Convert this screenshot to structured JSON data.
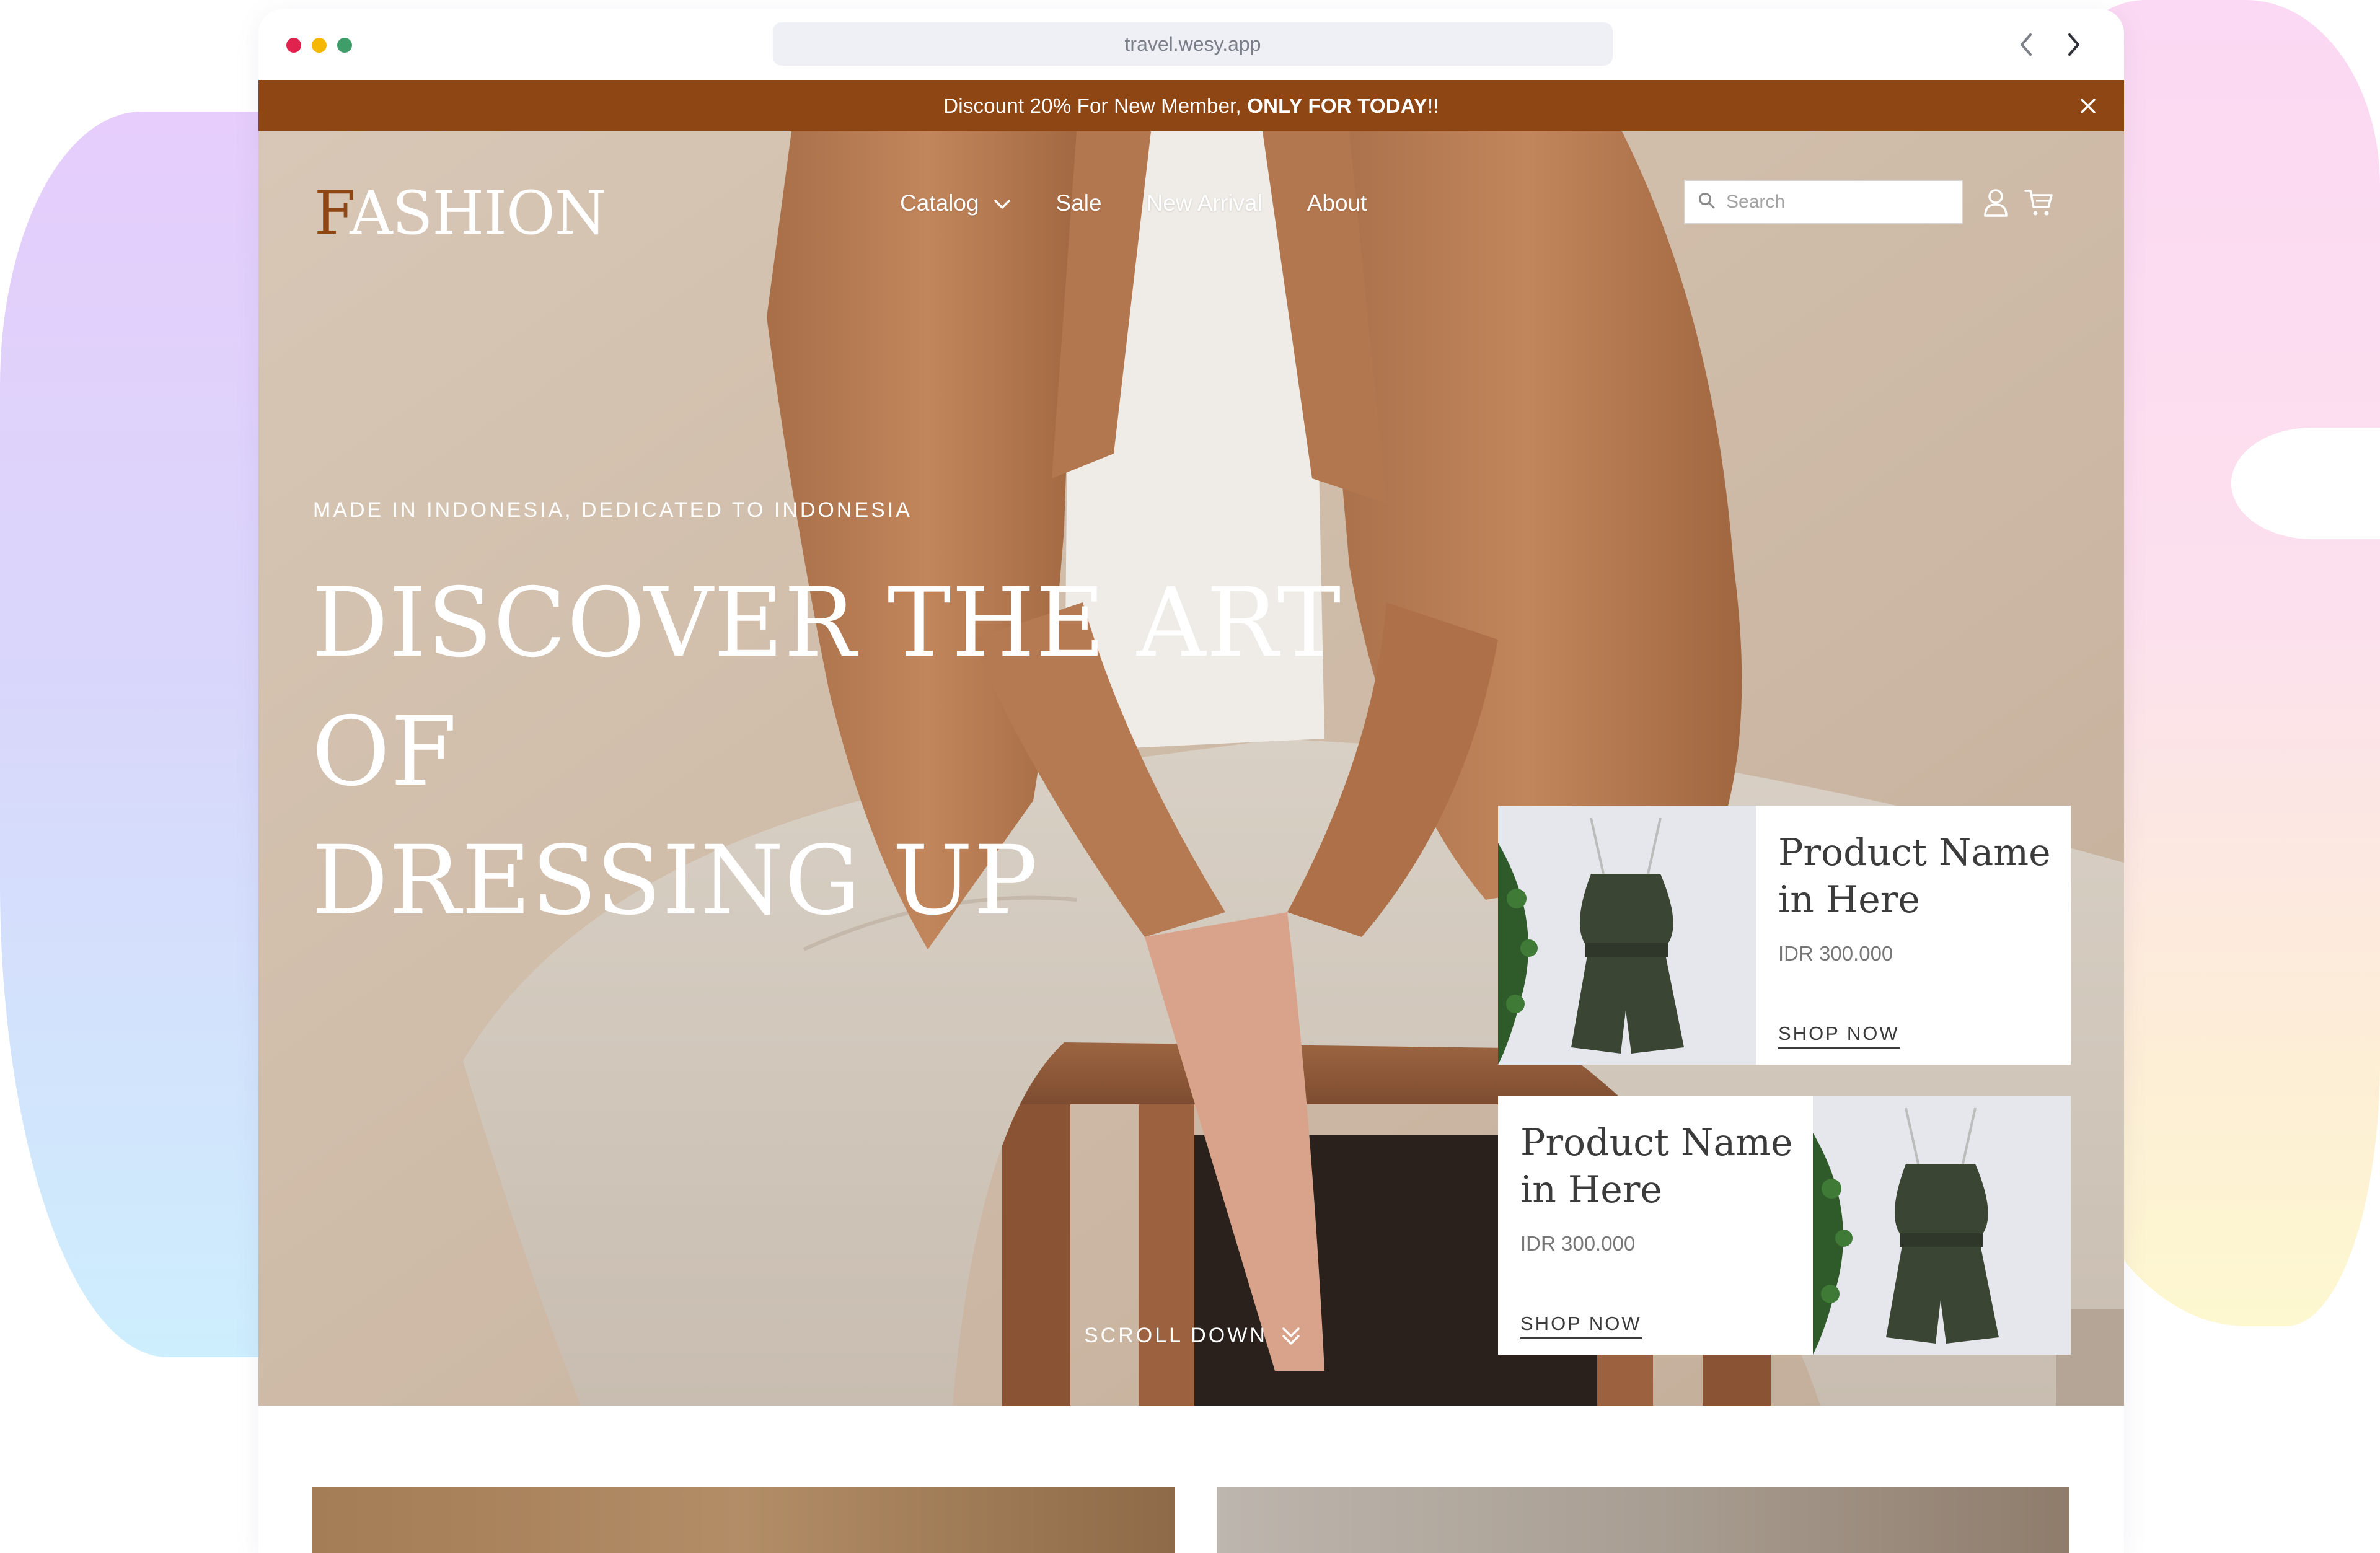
{
  "browser": {
    "url": "travel.wesy.app"
  },
  "promo": {
    "text_regular": "Discount 20% For New Member, ",
    "text_bold": "ONLY FOR TODAY",
    "text_tail": "!!"
  },
  "header": {
    "logo_first": "F",
    "logo_rest": "ASHION",
    "nav": [
      "Catalog",
      "Sale",
      "New Arrival",
      "About"
    ],
    "search_placeholder": "Search"
  },
  "hero": {
    "tagline": "MADE IN INDONESIA, DEDICATED TO INDONESIA",
    "headline_line1": "DISCOVER THE ART OF",
    "headline_line2": "DRESSING UP",
    "scroll_label": "SCROLL DOWN"
  },
  "products": [
    {
      "name": "Product Name in Here",
      "price": "IDR 300.000",
      "cta": "SHOP NOW"
    },
    {
      "name": "Product Name in Here",
      "price": "IDR 300.000",
      "cta": "SHOP NOW"
    }
  ],
  "colors": {
    "brand": "#8e4714",
    "text_dark": "#3b3b3b",
    "text_muted": "#777777",
    "dot_red": "#e0234e",
    "dot_yellow": "#f5b700",
    "dot_green": "#3e9d69"
  },
  "icons": [
    "chevron-left-icon",
    "chevron-right-icon",
    "close-icon",
    "chevron-down-icon",
    "search-icon",
    "user-icon",
    "cart-icon",
    "double-chevron-down-icon"
  ]
}
